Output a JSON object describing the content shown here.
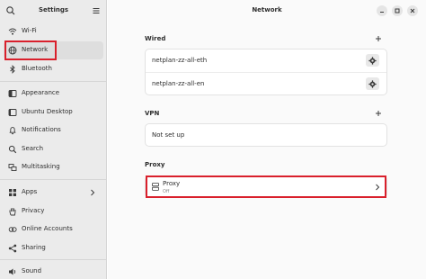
{
  "sidebar": {
    "title": "Settings",
    "search_icon": "search-icon",
    "menu_icon": "hamburger-menu-icon",
    "items": [
      {
        "label": "Wi-Fi",
        "icon": "wifi-icon"
      },
      {
        "label": "Network",
        "icon": "network-icon",
        "selected": true
      },
      {
        "label": "Bluetooth",
        "icon": "bluetooth-icon"
      },
      {
        "label": "Appearance",
        "icon": "appearance-icon"
      },
      {
        "label": "Ubuntu Desktop",
        "icon": "ubuntu-desktop-icon"
      },
      {
        "label": "Notifications",
        "icon": "bell-icon"
      },
      {
        "label": "Search",
        "icon": "search-icon"
      },
      {
        "label": "Multitasking",
        "icon": "multitasking-icon"
      },
      {
        "label": "Apps",
        "icon": "apps-icon"
      },
      {
        "label": "Privacy",
        "icon": "hand-icon"
      },
      {
        "label": "Online Accounts",
        "icon": "online-accounts-icon"
      },
      {
        "label": "Sharing",
        "icon": "share-icon"
      },
      {
        "label": "Sound",
        "icon": "speaker-icon"
      }
    ]
  },
  "main": {
    "title": "Network",
    "wired": {
      "title": "Wired",
      "connections": [
        {
          "name": "netplan-zz-all-eth"
        },
        {
          "name": "netplan-zz-all-en"
        }
      ]
    },
    "vpn": {
      "title": "VPN",
      "status": "Not set up"
    },
    "proxy": {
      "title": "Proxy",
      "row_label": "Proxy",
      "row_status": "Off"
    }
  },
  "colors": {
    "highlight": "#d9202c",
    "sidebar_bg": "#ebebeb",
    "main_bg": "#fafafa",
    "selected_bg": "#dedede"
  }
}
